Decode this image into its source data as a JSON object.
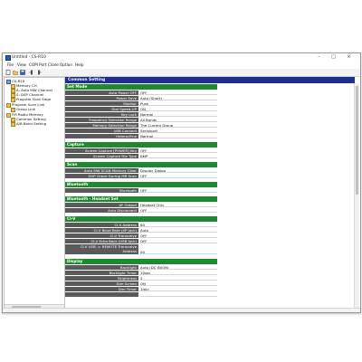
{
  "window": {
    "title": "Untitled - CS-R10",
    "minimize": "–",
    "maximize": "□",
    "close": "×"
  },
  "menu": [
    "File",
    "View",
    "COM Port",
    "Clone",
    "Option",
    "Help"
  ],
  "toolbar": [
    "new-icon",
    "open-icon",
    "save-icon",
    "read-from-radio-icon",
    "write-to-radio-icon"
  ],
  "tree": {
    "root": "CS-R10",
    "items": [
      "Memory CH",
      "A: Auto MW Channel",
      "S: DSP Channel",
      "Program Scan Edge",
      "Program Scan Link",
      "Group Link",
      "FM Radio Memory",
      "Common Setting",
      "A/B Band Setting"
    ]
  },
  "content": {
    "header": "Common Setting",
    "sections": [
      {
        "title": "Set Mode",
        "rows": [
          {
            "label": "Auto Power OFF",
            "value": "OFF"
          },
          {
            "label": "Power Save",
            "value": "Auto (Short)"
          },
          {
            "label": "Monitor",
            "value": "Push"
          },
          {
            "label": "Dial Speed-UP",
            "value": "ON"
          },
          {
            "label": "Key Lock",
            "value": "Normal"
          },
          {
            "label": "Frequency Selection Range",
            "value": "All Bands"
          },
          {
            "label": "Memory Selection Range",
            "value": "The Current Group"
          },
          {
            "label": "USB Connect",
            "value": "Serialport"
          },
          {
            "label": "HeterodYne",
            "value": "Normal"
          }
        ]
      },
      {
        "title": "Capture",
        "rows": [
          {
            "label": "Screen Capture [POWER] Key",
            "value": "OFF"
          },
          {
            "label": "Screen Capture File Type",
            "value": "BMP"
          }
        ]
      },
      {
        "title": "Scan",
        "rows": [
          {
            "label": "Auto MW SCAN Memory Clear",
            "value": "Display Dialog"
          },
          {
            "label": "DVP Check During MR Scan",
            "value": "OFF"
          }
        ]
      },
      {
        "title": "Bluetooth",
        "rows": [
          {
            "label": "Bluetooth",
            "value": "OFF"
          }
        ]
      },
      {
        "title": "Bluetooth - Headset Set",
        "rows": [
          {
            "label": "AF Output",
            "value": "Headset Only"
          },
          {
            "label": "Auto Disconnect",
            "value": "OFF"
          }
        ]
      },
      {
        "title": "CI-V",
        "rows": [
          {
            "label": "CI-V Address",
            "value": "80"
          },
          {
            "label": "CI-V Baud Rate (SP Jack)",
            "value": "Auto"
          },
          {
            "label": "CI-V Transceive",
            "value": "OFF"
          },
          {
            "label": "CI-V Echo Back (USB Jack)",
            "value": "OFF"
          },
          {
            "label": "CI-V USB -> REMOTE Transceive Address",
            "value": "00"
          }
        ]
      },
      {
        "title": "Display",
        "rows": [
          {
            "label": "Backlight",
            "value": "Auto (DC IN/ON)"
          },
          {
            "label": "Backlight Timer",
            "value": "10sec"
          },
          {
            "label": "Brightness",
            "value": "5"
          },
          {
            "label": "Dim Screen",
            "value": "ON"
          },
          {
            "label": "Dim Timer",
            "value": "1min"
          }
        ]
      }
    ]
  }
}
